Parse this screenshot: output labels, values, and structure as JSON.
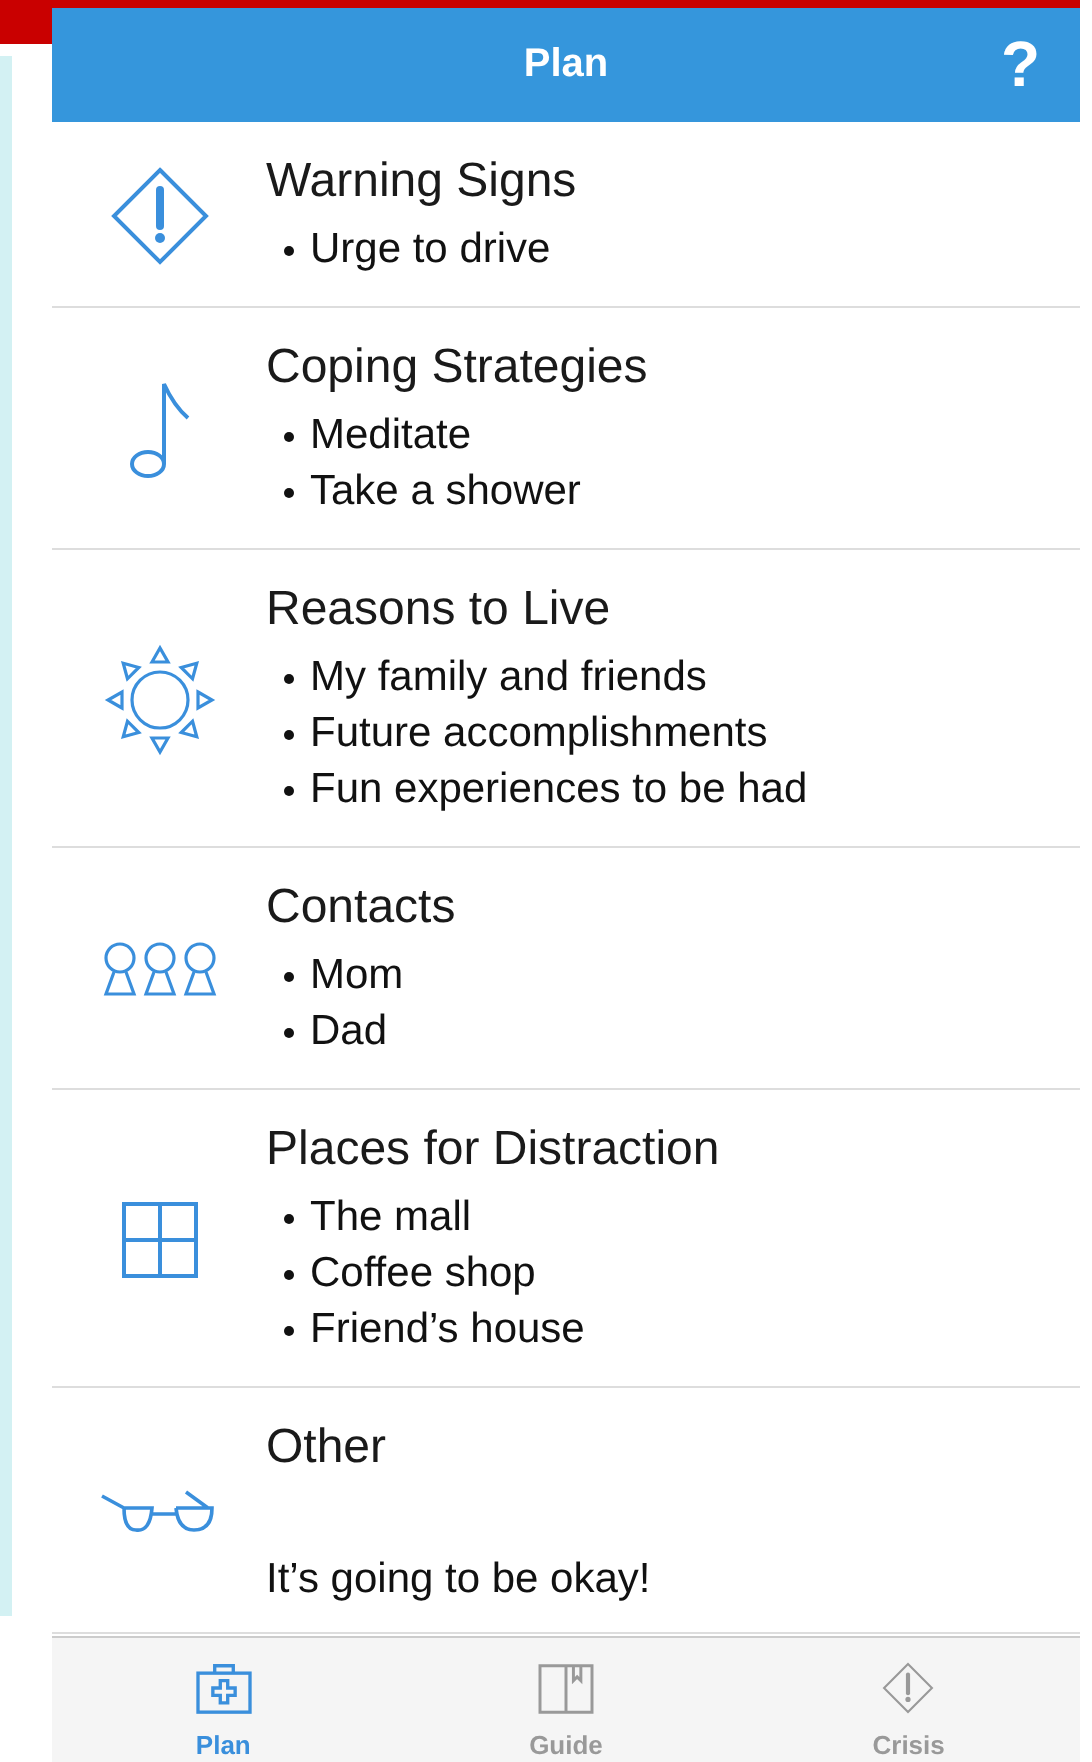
{
  "header": {
    "title": "Plan",
    "help": "?"
  },
  "sections": [
    {
      "kind": "warning",
      "title": "Warning Signs",
      "items": [
        "Urge to drive"
      ]
    },
    {
      "kind": "note",
      "title": "Coping Strategies",
      "items": [
        "Meditate",
        "Take a shower"
      ]
    },
    {
      "kind": "sun",
      "title": "Reasons to Live",
      "items": [
        "My family and friends",
        "Future accomplishments",
        "Fun experiences to be had"
      ]
    },
    {
      "kind": "people",
      "title": "Contacts",
      "items": [
        "Mom",
        "Dad"
      ]
    },
    {
      "kind": "window",
      "title": "Places for Distraction",
      "items": [
        "The mall",
        "Coffee shop",
        "Friend’s house"
      ]
    },
    {
      "kind": "glasses",
      "title": "Other",
      "text": "It’s going to be okay!"
    }
  ],
  "tabs": [
    {
      "kind": "kit",
      "label": "Plan",
      "selected": true
    },
    {
      "kind": "book",
      "label": "Guide",
      "selected": false
    },
    {
      "kind": "warning",
      "label": "Crisis",
      "selected": false
    }
  ]
}
